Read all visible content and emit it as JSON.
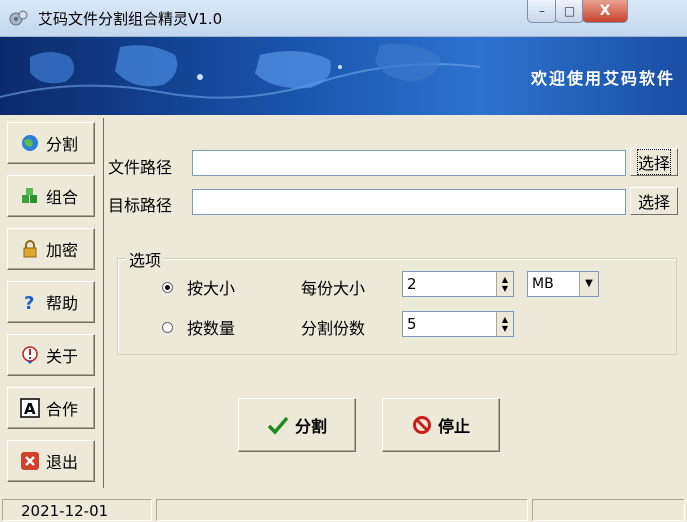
{
  "window": {
    "title": "艾码文件分割组合精灵V1.0",
    "buttons": {
      "minimize": "–",
      "maximize": "□",
      "close": "X"
    }
  },
  "banner": {
    "text": "欢迎使用艾码软件"
  },
  "sidebar": {
    "items": [
      {
        "label": "分割",
        "icon": "globe-icon"
      },
      {
        "label": "组合",
        "icon": "blocks-icon"
      },
      {
        "label": "加密",
        "icon": "lock-icon"
      },
      {
        "label": "帮助",
        "icon": "question-icon"
      },
      {
        "label": "关于",
        "icon": "info-icon"
      },
      {
        "label": "合作",
        "icon": "letter-a-icon"
      },
      {
        "label": "退出",
        "icon": "exit-icon"
      }
    ]
  },
  "form": {
    "file_path_label": "文件路径",
    "file_path_value": "",
    "file_browse_label": "选择",
    "target_path_label": "目标路径",
    "target_path_value": "",
    "target_browse_label": "选择"
  },
  "options": {
    "title": "选项",
    "by_size_label": "按大小",
    "by_size_checked": true,
    "by_count_label": "按数量",
    "by_count_checked": false,
    "size_each_label": "每份大小",
    "size_each_value": "2",
    "unit_value": "MB",
    "split_count_label": "分割份数",
    "split_count_value": "5"
  },
  "actions": {
    "split_label": "分割",
    "stop_label": "停止"
  },
  "status": {
    "date": "2021-12-01",
    "pane2": "",
    "pane3": "",
    "pane4": ""
  },
  "colors": {
    "accent_blue": "#1a57b0",
    "window_bg": "#ece9d8"
  }
}
